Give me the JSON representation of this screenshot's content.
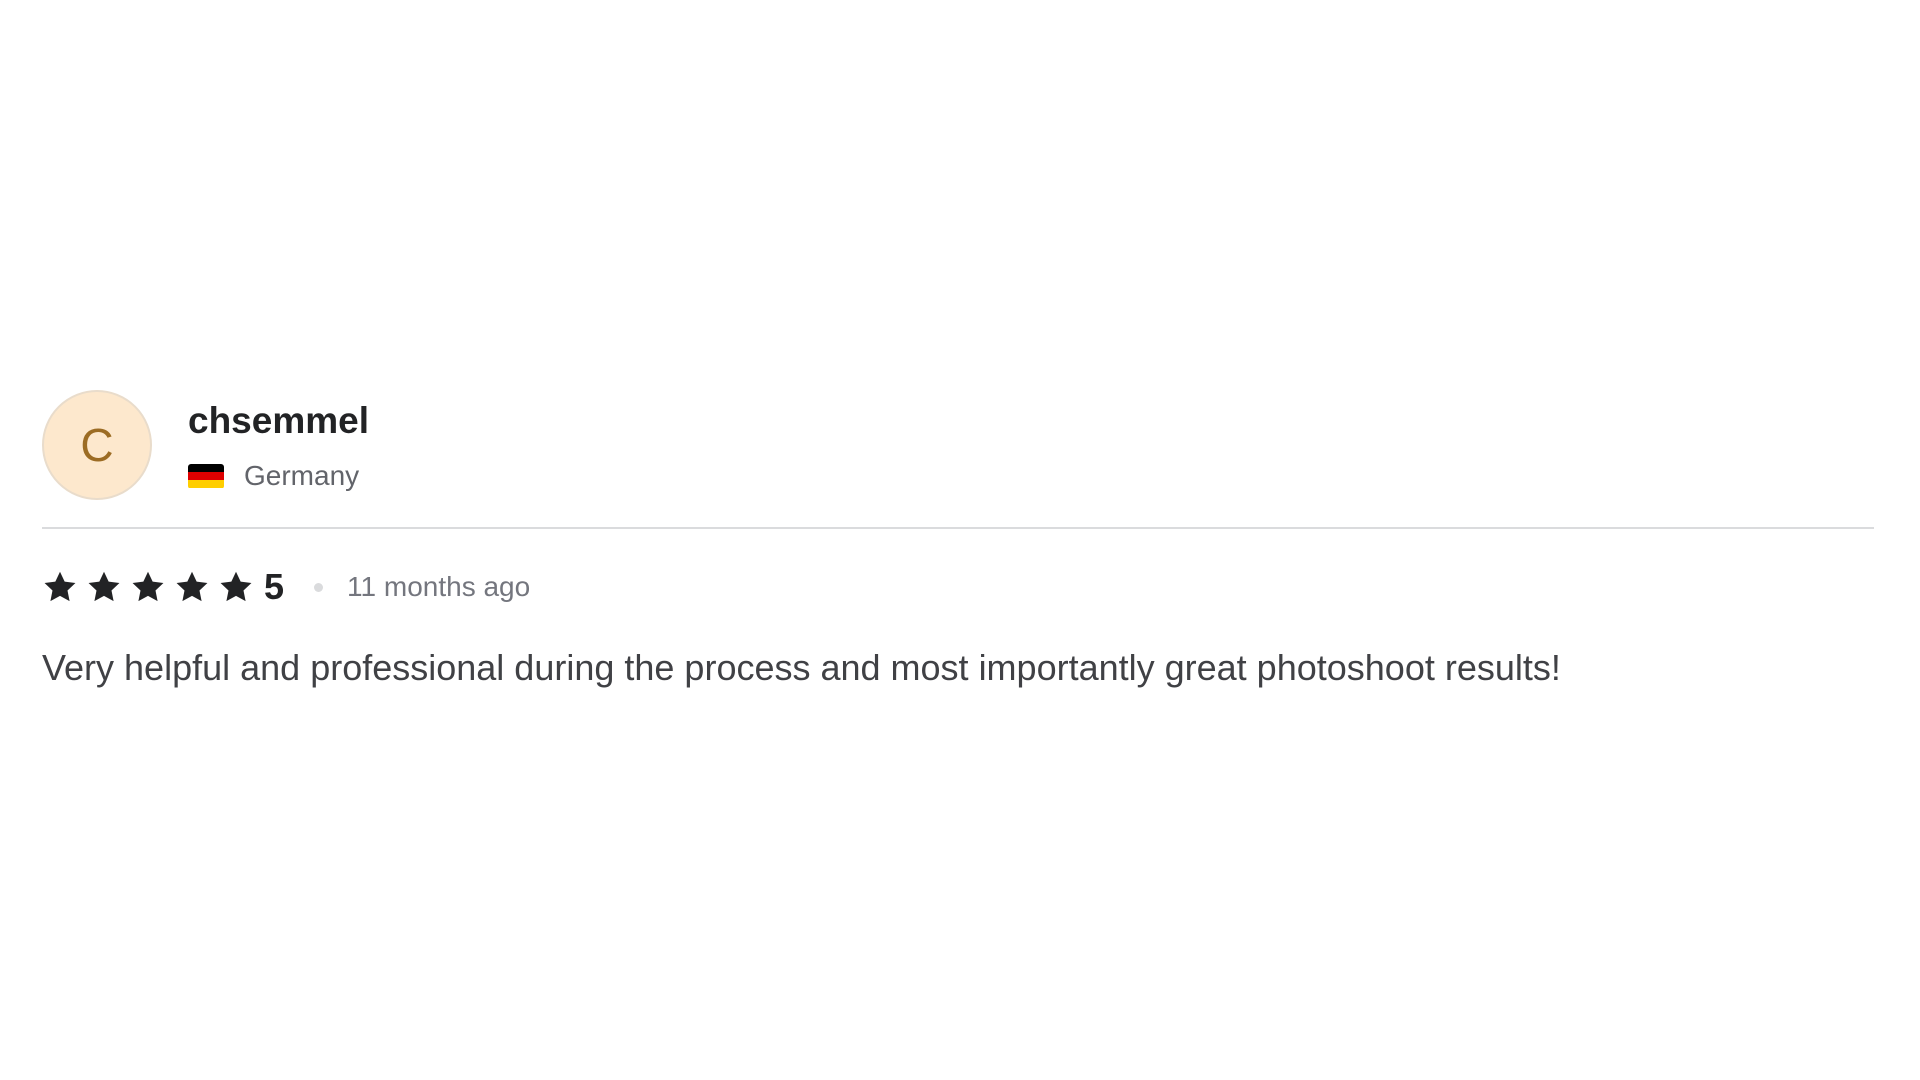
{
  "review": {
    "reviewer": {
      "avatar_initial": "C",
      "avatar_bg_color": "#fde8cd",
      "avatar_text_color": "#9c6c24",
      "name": "chsemmel",
      "country": "Germany",
      "flag_icon": "germany-flag-icon",
      "flag_colors": [
        "#000000",
        "#dd0000",
        "#ffce00"
      ]
    },
    "rating": {
      "stars_filled": 5,
      "stars_total": 5,
      "star_icon": "star-icon",
      "value": "5"
    },
    "time_ago": "11 months ago",
    "text": "Very helpful and professional during the process and most importantly great photoshoot results!"
  }
}
